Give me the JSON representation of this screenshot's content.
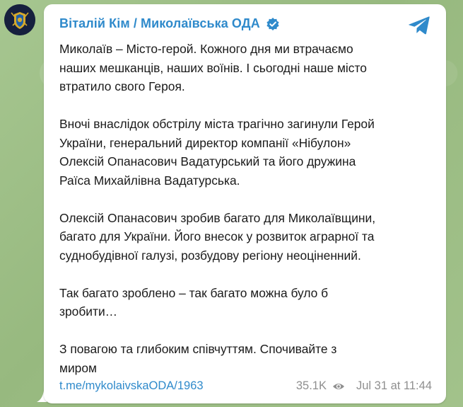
{
  "channel": {
    "name": "Віталій Кім / Миколаївська ОДА",
    "verified_icon": "verified-badge-icon",
    "avatar_icon": "coat-of-arms-avatar",
    "accent_color": "#2f8acb"
  },
  "app": {
    "telegram_icon": "telegram-plane-icon"
  },
  "message": {
    "paragraphs": [
      "Миколаїв – Місто-герой. Кожного дня ми втрачаємо\nнаших мешканців, наших воїнів. І сьогодні наше місто\nвтратило свого Героя.",
      "Вночі внаслідок обстрілу міста трагічно загинули Герой\nУкраїни, генеральний директор компанії «Нібулон»\nОлексій Опанасович Вадатурський та його дружина\nРаїса Михайлівна Вадатурська.",
      "Олексій Опанасович зробив багато для Миколаївщини,\nбагато для України. Його внесок у розвиток аграрної та\nсуднобудівної галузі, розбудову регіону неоціненний.",
      "Так багато зроблено – так багато можна було б\nзробити…",
      "З повагою та глибоким співчуттям. Спочивайте з\nмиром"
    ]
  },
  "footer": {
    "link": "t.me/mykolaivskaODA/1963",
    "views": "35.1K",
    "views_icon": "eye-icon",
    "timestamp": "Jul 31 at 11:44"
  }
}
